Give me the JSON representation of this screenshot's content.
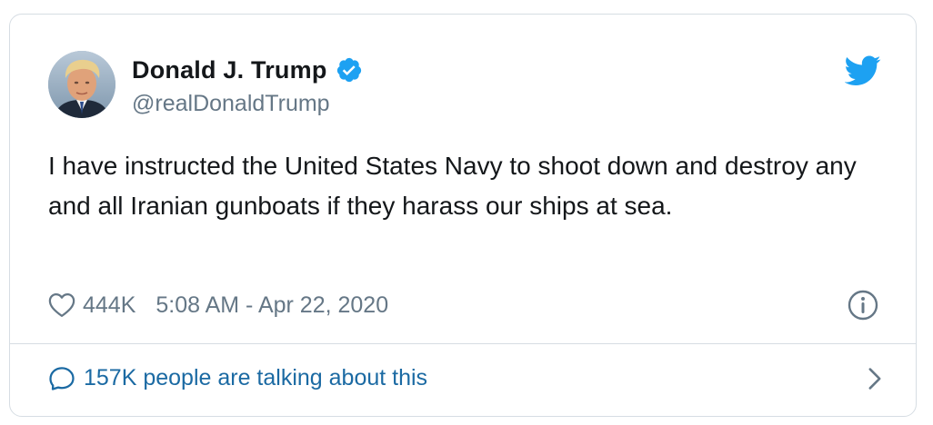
{
  "tweet": {
    "author": {
      "display_name": "Donald J. Trump",
      "handle": "@realDonaldTrump",
      "verified": true
    },
    "text": "I have instructed the United States Navy to shoot down and destroy any and all Iranian gunboats if they harass our ships at sea.",
    "likes": "444K",
    "timestamp": "5:08 AM - Apr 22, 2020",
    "talking_label": "157K people are talking about this"
  },
  "colors": {
    "twitter_blue": "#1da1f2",
    "link_blue": "#1b6aa3",
    "secondary_text": "#657786",
    "border": "#d6dde3"
  },
  "icons": {
    "verified": "verified-badge-icon",
    "brand": "twitter-bird-icon",
    "like": "heart-icon",
    "info": "info-icon",
    "conversation": "speech-bubble-icon",
    "navigate": "chevron-right-icon"
  }
}
